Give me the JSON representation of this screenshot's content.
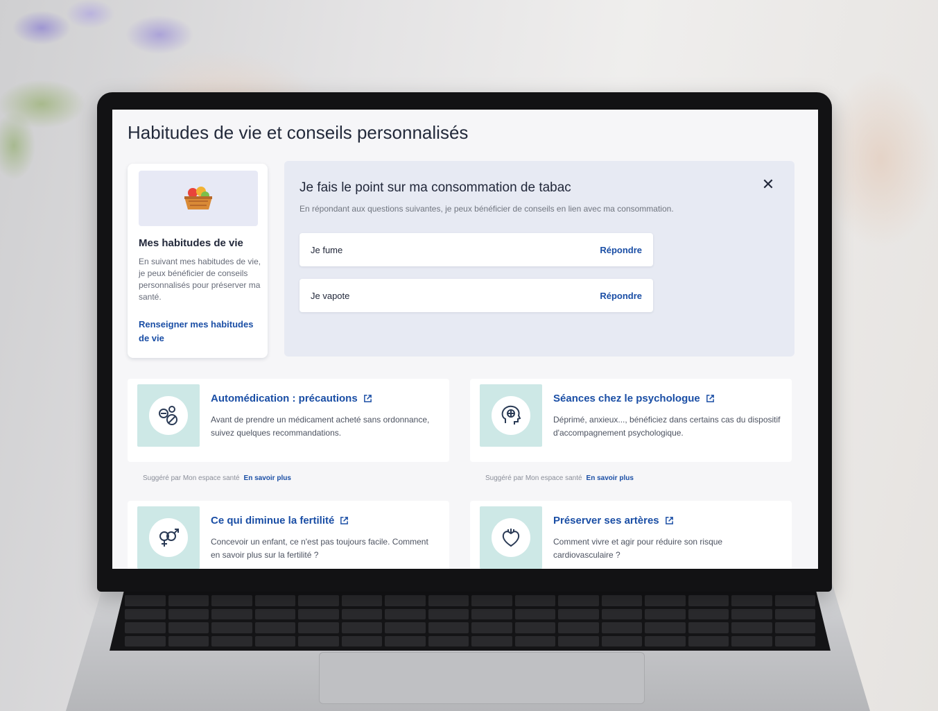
{
  "page": {
    "title": "Habitudes de vie et conseils personnalisés"
  },
  "habits_card": {
    "title": "Mes habitudes de vie",
    "description": "En suivant mes habitudes de vie, je peux bénéficier de conseils personnalisés pour préserver ma santé.",
    "link": "Renseigner mes habitudes de vie"
  },
  "tabac": {
    "title": "Je fais le point sur ma consommation de tabac",
    "subtitle": "En répondant aux questions suivantes, je peux bénéficier de conseils en lien avec ma consommation.",
    "close_icon": "close-icon",
    "rows": [
      {
        "label": "Je fume",
        "action": "Répondre"
      },
      {
        "label": "Je vapote",
        "action": "Répondre"
      }
    ]
  },
  "tiles": [
    {
      "title": "Automédication : précautions",
      "description": "Avant de prendre un médicament acheté sans ordonnance, suivez quelques recommandations.",
      "icon": "pills-icon",
      "footer": {
        "text": "Suggéré par Mon espace santé",
        "link": "En savoir plus"
      }
    },
    {
      "title": "Séances chez le psychologue",
      "description": "Déprimé, anxieux..., bénéficiez dans certains cas du dispositif d'accompagnement psychologique.",
      "icon": "head-brain-icon",
      "footer": {
        "text": "Suggéré par Mon espace santé",
        "link": "En savoir plus"
      }
    },
    {
      "title": "Ce qui diminue la fertilité",
      "description": "Concevoir un enfant, ce n'est pas toujours facile. Comment en savoir plus sur la fertilité ?",
      "icon": "gender-symbols-icon"
    },
    {
      "title": "Préserver ses artères",
      "description": "Comment vivre et agir pour réduire son risque cardiovasculaire ?",
      "icon": "heart-icon"
    }
  ],
  "colors": {
    "link_blue": "#1a4ea5",
    "panel_bg": "#e7eaf3",
    "icon_tile_bg": "#cde8e6"
  }
}
